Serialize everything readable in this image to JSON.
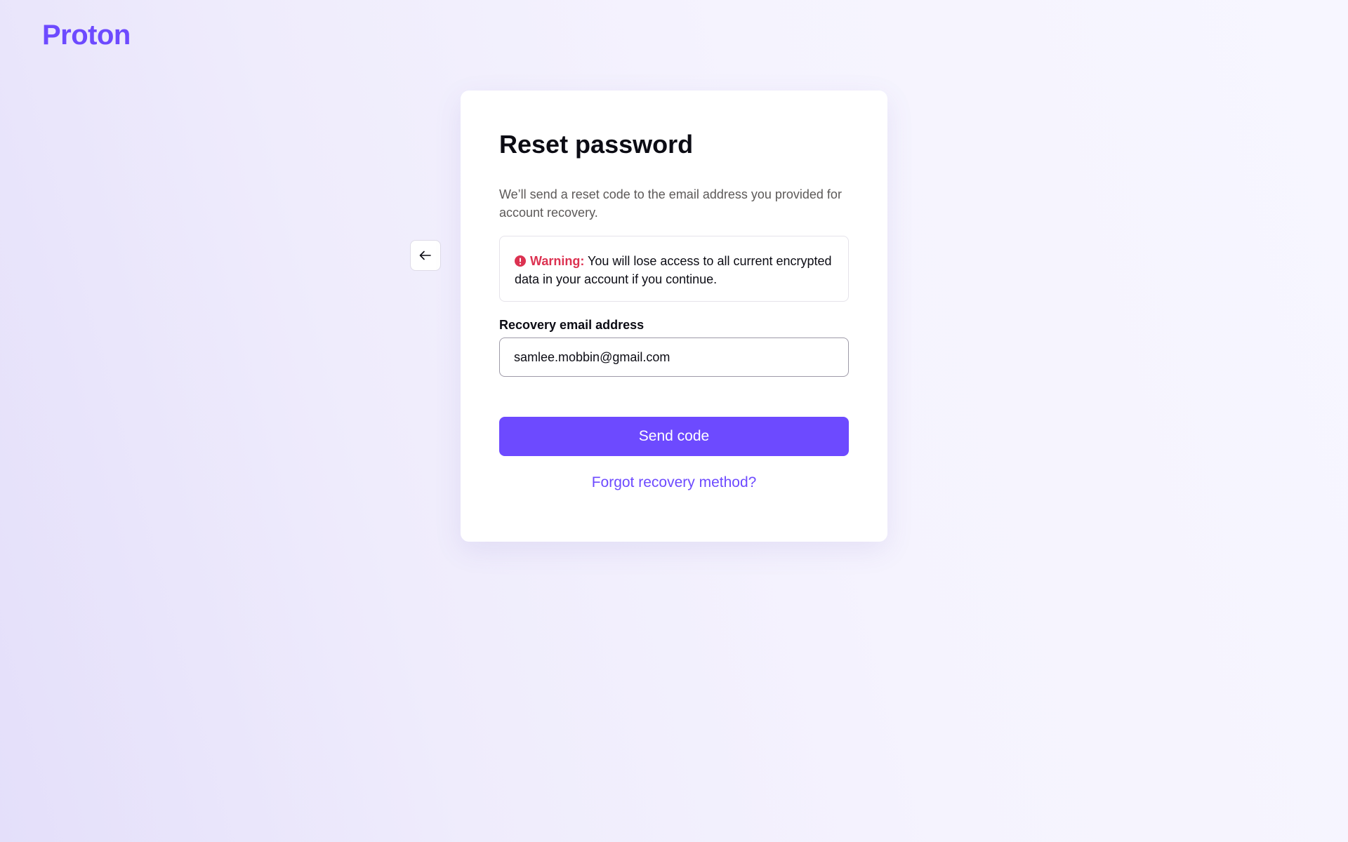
{
  "brand": {
    "logo_text": "Proton",
    "accent_color": "#6d4aff",
    "warning_color": "#dc3251"
  },
  "navigation": {
    "back_icon": "arrow-left-icon"
  },
  "reset_form": {
    "title": "Reset password",
    "subtitle": "We’ll send a reset code to the email address you provided for account recovery.",
    "warning": {
      "icon": "alert-circle-icon",
      "label": "Warning:",
      "message": "You will lose access to all current encrypted data in your account if you continue."
    },
    "email_label": "Recovery email address",
    "email_value": "samlee.mobbin@gmail.com",
    "submit_label": "Send code",
    "forgot_link": "Forgot recovery method?"
  }
}
